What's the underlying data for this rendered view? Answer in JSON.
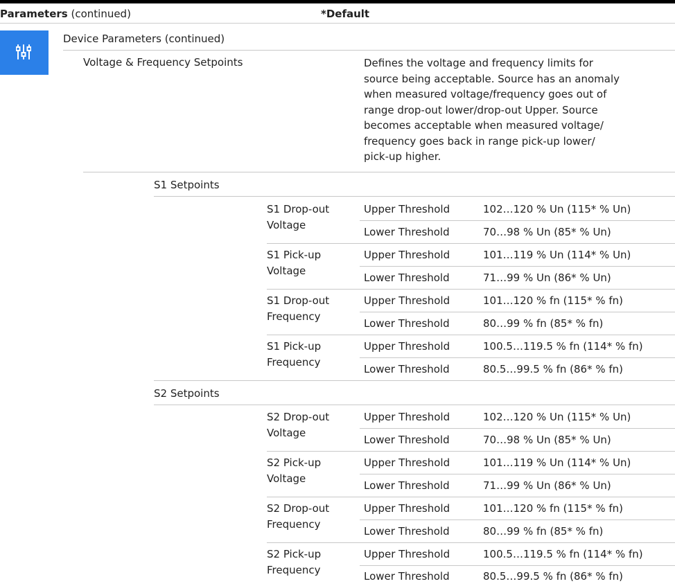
{
  "header": {
    "parameters_bold": "Parameters",
    "parameters_rest": " (continued)",
    "default_label": "*Default"
  },
  "section": {
    "icon": "sliders-icon",
    "accent": "#2b80e8",
    "title": "Device Parameters (continued)",
    "subsection": "Voltage & Frequency Setpoints",
    "description_lines": [
      "Defines the voltage and frequency limits for",
      "source being acceptable. Source has an anomaly",
      "when measured voltage/frequency goes out of",
      "range drop-out lower/drop-out Upper. Source",
      "becomes acceptable when measured voltage/",
      "frequency goes back in range pick-up lower/",
      "pick-up higher."
    ]
  },
  "s1": {
    "title": "S1 Setpoints",
    "groups": [
      {
        "name": [
          "S1 Drop-out",
          "Voltage"
        ],
        "upper": {
          "label": "Upper Threshold",
          "value": "102…120 % Un (115* % Un)"
        },
        "lower": {
          "label": "Lower Threshold",
          "value": "70…98 % Un (85* % Un)"
        }
      },
      {
        "name": [
          "S1 Pick-up",
          "Voltage"
        ],
        "upper": {
          "label": "Upper Threshold",
          "value": "101…119 % Un (114* % Un)"
        },
        "lower": {
          "label": "Lower Threshold",
          "value": "71…99 % Un (86* % Un)"
        }
      },
      {
        "name": [
          "S1 Drop-out",
          "Frequency"
        ],
        "upper": {
          "label": "Upper Threshold",
          "value": "101…120 % fn (115* % fn)"
        },
        "lower": {
          "label": "Lower Threshold",
          "value": "80…99 % fn (85* % fn)"
        }
      },
      {
        "name": [
          "S1 Pick-up",
          "Frequency"
        ],
        "upper": {
          "label": "Upper Threshold",
          "value": "100.5…119.5 % fn (114* % fn)"
        },
        "lower": {
          "label": "Lower Threshold",
          "value": "80.5…99.5 % fn (86* % fn)"
        }
      }
    ]
  },
  "s2": {
    "title": "S2 Setpoints",
    "groups": [
      {
        "name": [
          "S2 Drop-out",
          "Voltage"
        ],
        "upper": {
          "label": "Upper Threshold",
          "value": "102…120 % Un (115* % Un)"
        },
        "lower": {
          "label": "Lower Threshold",
          "value": "70…98 % Un (85* % Un)"
        }
      },
      {
        "name": [
          "S2 Pick-up",
          "Voltage"
        ],
        "upper": {
          "label": "Upper Threshold",
          "value": "101…119 % Un (114* % Un)"
        },
        "lower": {
          "label": "Lower Threshold",
          "value": "71…99 % Un (86* % Un)"
        }
      },
      {
        "name": [
          "S2 Drop-out",
          "Frequency"
        ],
        "upper": {
          "label": "Upper Threshold",
          "value": "101…120 % fn (115* % fn)"
        },
        "lower": {
          "label": "Lower Threshold",
          "value": "80…99 % fn (85* % fn)"
        }
      },
      {
        "name": [
          "S2 Pick-up",
          "Frequency"
        ],
        "upper": {
          "label": "Upper Threshold",
          "value": "100.5…119.5 % fn (114* % fn)"
        },
        "lower": {
          "label": "Lower Threshold",
          "value": "80.5…99.5 % fn (86* % fn)"
        }
      }
    ]
  }
}
